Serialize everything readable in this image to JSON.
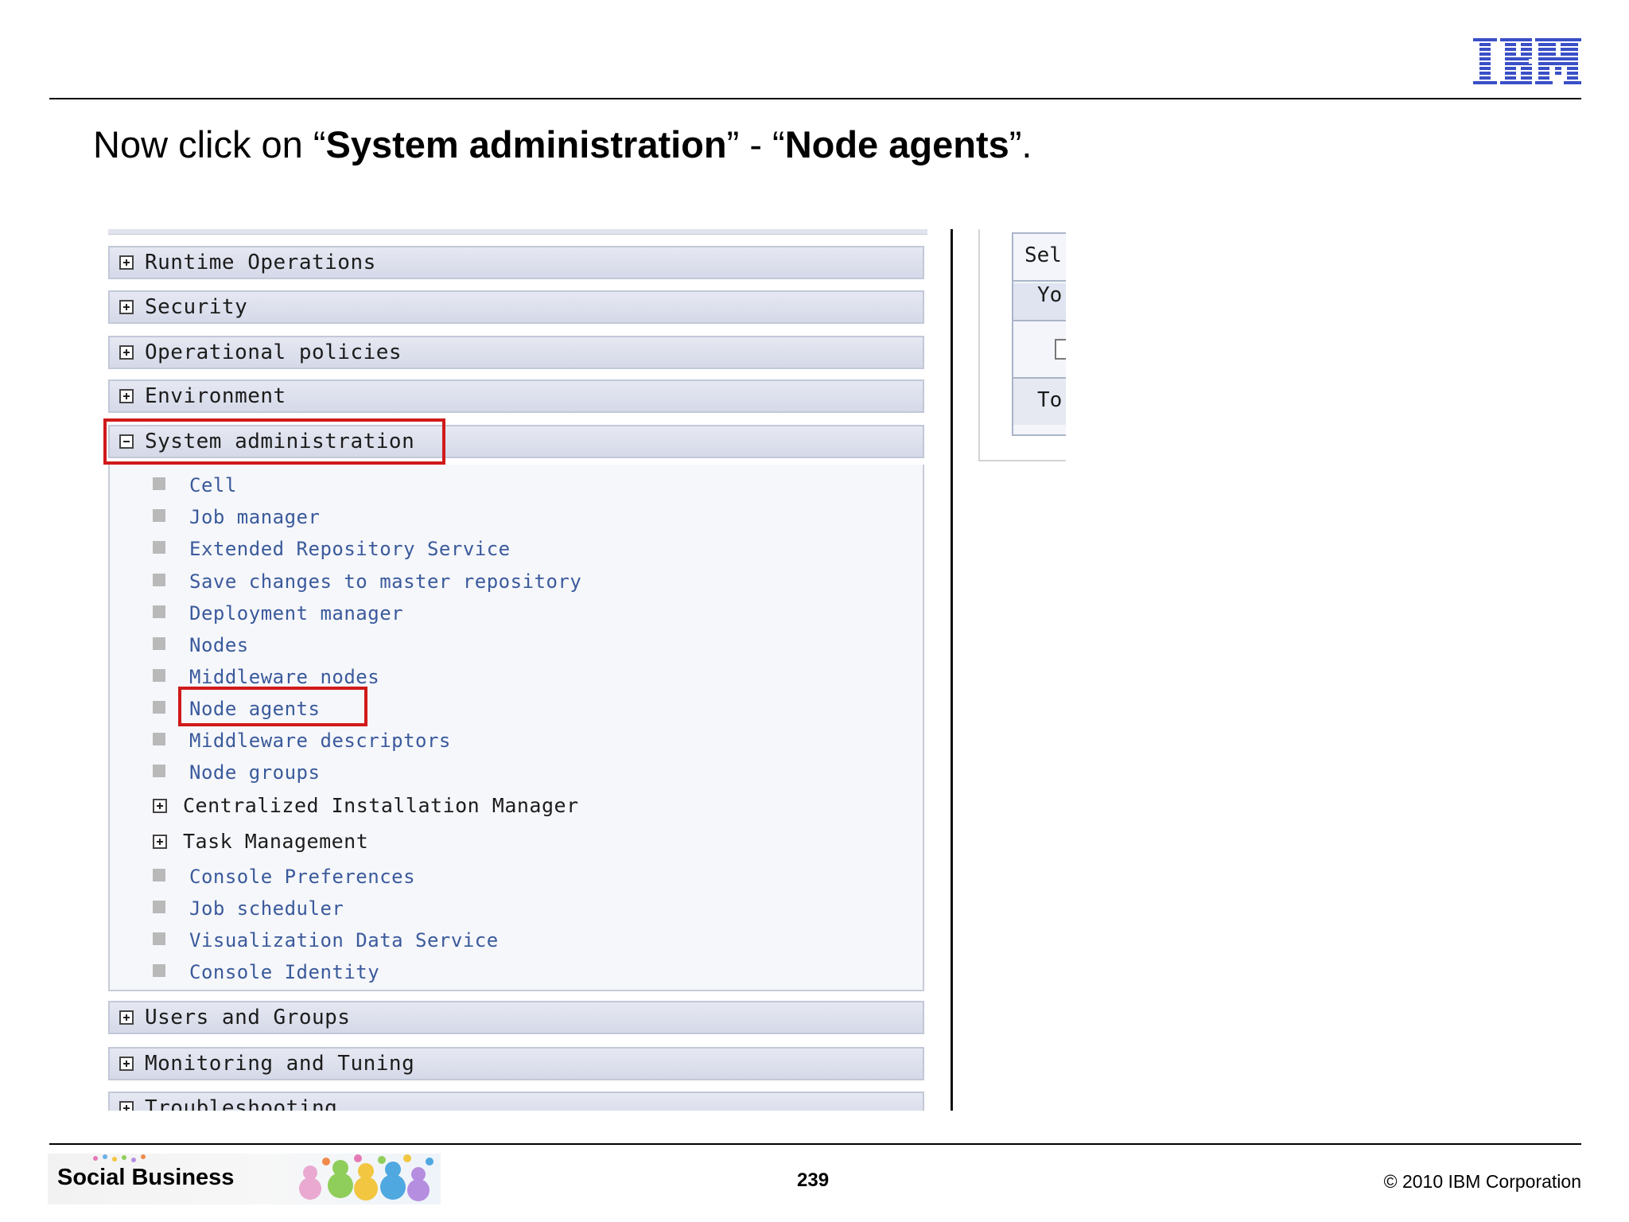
{
  "slide": {
    "logo_text": "IBM",
    "instruction": {
      "prefix": "Now click on “",
      "bold1": "System administration",
      "middle": "” - “",
      "bold2": "Node agents",
      "suffix": "”."
    },
    "footer": {
      "brand": "Social Business",
      "page_number": "239",
      "copyright": "© 2010 IBM Corporation"
    }
  },
  "nav": {
    "categories_top": [
      {
        "label": "Runtime Operations",
        "state": "collapsed"
      },
      {
        "label": "Security",
        "state": "collapsed"
      },
      {
        "label": "Operational policies",
        "state": "collapsed"
      },
      {
        "label": "Environment",
        "state": "collapsed"
      }
    ],
    "system_admin": {
      "label": "System administration",
      "state": "expanded",
      "items": [
        "Cell",
        "Job manager",
        "Extended Repository Service",
        "Save changes to master repository",
        "Deployment manager",
        "Nodes",
        "Middleware nodes",
        "Node agents",
        "Middleware descriptors",
        "Node groups"
      ],
      "subcategories": [
        "Centralized Installation Manager",
        "Task Management"
      ],
      "items_after": [
        "Console Preferences",
        "Job scheduler",
        "Visualization Data Service",
        "Console Identity"
      ]
    },
    "categories_bottom": [
      {
        "label": "Users and Groups",
        "state": "collapsed"
      },
      {
        "label": "Monitoring and Tuning",
        "state": "collapsed"
      },
      {
        "label": "Troubleshooting",
        "state": "collapsed"
      }
    ]
  },
  "right_fragment": {
    "rows": [
      "Sel",
      "Yo",
      "",
      "To"
    ]
  },
  "colors": {
    "highlight": "#d01a1a",
    "link": "#3a5a9b",
    "ibm_blue": "#3a4fc7"
  }
}
